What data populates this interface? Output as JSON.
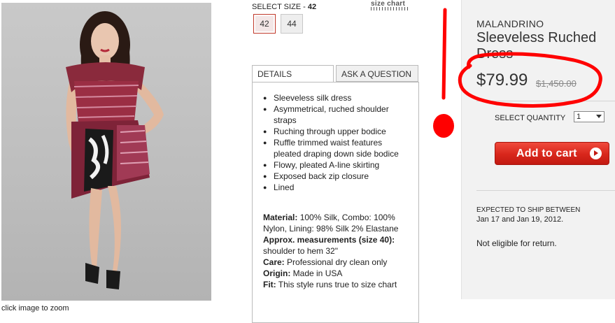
{
  "product": {
    "brand": "MALANDRINO",
    "name": "Sleeveless Ruched Dress",
    "price": "$79.99",
    "original_price": "$1,450.00"
  },
  "image": {
    "zoom_caption": "click image to zoom"
  },
  "size": {
    "label": "SELECT SIZE - ",
    "selected": "42",
    "chart_link": "size chart",
    "options": [
      "42",
      "44"
    ]
  },
  "tabs": [
    "DETAILS",
    "ASK A QUESTION"
  ],
  "details": {
    "bullets": [
      "Sleeveless silk dress",
      "Asymmetrical, ruched shoulder straps",
      "Ruching through upper bodice",
      "Ruffle trimmed waist features pleated draping down side bodice",
      "Flowy, pleated A-line skirting",
      "Exposed back zip closure",
      "Lined"
    ],
    "specs": [
      {
        "key": "Material:",
        "value": " 100% Silk, Combo: 100% Nylon, Lining: 98% Silk 2% Elastane"
      },
      {
        "key": "Approx. measurements (size 40):",
        "value": " shoulder to hem 32\""
      },
      {
        "key": "Care:",
        "value": " Professional dry clean only"
      },
      {
        "key": "Origin:",
        "value": " Made in USA"
      },
      {
        "key": "Fit:",
        "value": " This style runs true to size chart"
      }
    ]
  },
  "purchase": {
    "quantity_label": "SELECT QUANTITY",
    "quantity_value": "1",
    "add_to_cart": "Add to cart",
    "shipping_label": "EXPECTED TO SHIP BETWEEN",
    "shipping_dates": "Jan 17 and Jan 19, 2012.",
    "return_note": "Not eligible for return."
  },
  "colors": {
    "annotation_red": "#ff0000",
    "cart_button": "#d8261b",
    "right_panel_bg": "#f2f2f2"
  }
}
